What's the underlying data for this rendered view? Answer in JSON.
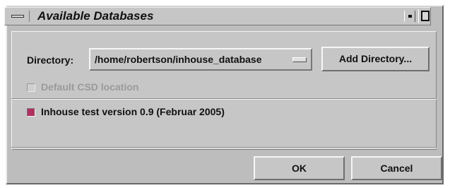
{
  "window": {
    "title": "Available Databases"
  },
  "directory": {
    "label": "Directory:",
    "selected": "/home/robertson/inhouse_database",
    "add_button_label": "Add Directory..."
  },
  "default_csd": {
    "label": "Default CSD location",
    "checked": false,
    "enabled": false
  },
  "databases": [
    {
      "label": "Inhouse test version 0.9 (Februar 2005)",
      "checked": true,
      "color": "#b03060"
    }
  ],
  "buttons": {
    "ok_label": "OK",
    "cancel_label": "Cancel"
  },
  "colors": {
    "window_bg": "#c6c6c6",
    "check_on": "#b03060"
  }
}
